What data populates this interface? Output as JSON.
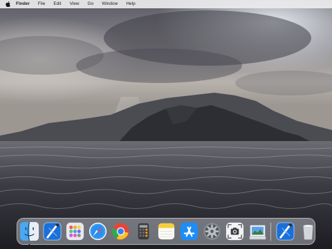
{
  "menubar": {
    "apple_icon": "apple-logo-icon",
    "app_name": "Finder",
    "items": [
      "File",
      "Edit",
      "View",
      "Go",
      "Window",
      "Help"
    ]
  },
  "dock": {
    "apps": [
      {
        "name": "Finder",
        "icon": "finder-icon",
        "running": true
      },
      {
        "name": "Xcode",
        "icon": "xcode-icon",
        "running": false
      },
      {
        "name": "Launchpad",
        "icon": "launchpad-icon",
        "running": false
      },
      {
        "name": "Safari",
        "icon": "safari-icon",
        "running": false
      },
      {
        "name": "Google Chrome",
        "icon": "chrome-icon",
        "running": false
      },
      {
        "name": "Calculator",
        "icon": "calculator-icon",
        "running": false
      },
      {
        "name": "Notes",
        "icon": "notes-icon",
        "running": false
      },
      {
        "name": "App Store",
        "icon": "app-store-icon",
        "running": false
      },
      {
        "name": "System Preferences",
        "icon": "system-preferences-icon",
        "running": false
      },
      {
        "name": "Screenshot",
        "icon": "screenshot-icon",
        "running": false
      },
      {
        "name": "Preview",
        "icon": "preview-icon",
        "running": false
      }
    ],
    "pinned": [
      {
        "name": "Xcode",
        "icon": "xcode-icon"
      },
      {
        "name": "Trash",
        "icon": "trash-icon"
      }
    ]
  },
  "colors": {
    "menubar_bg": "#ececee",
    "dock_bg": "#dce0e8",
    "accent_blue": "#1e8cf5"
  }
}
